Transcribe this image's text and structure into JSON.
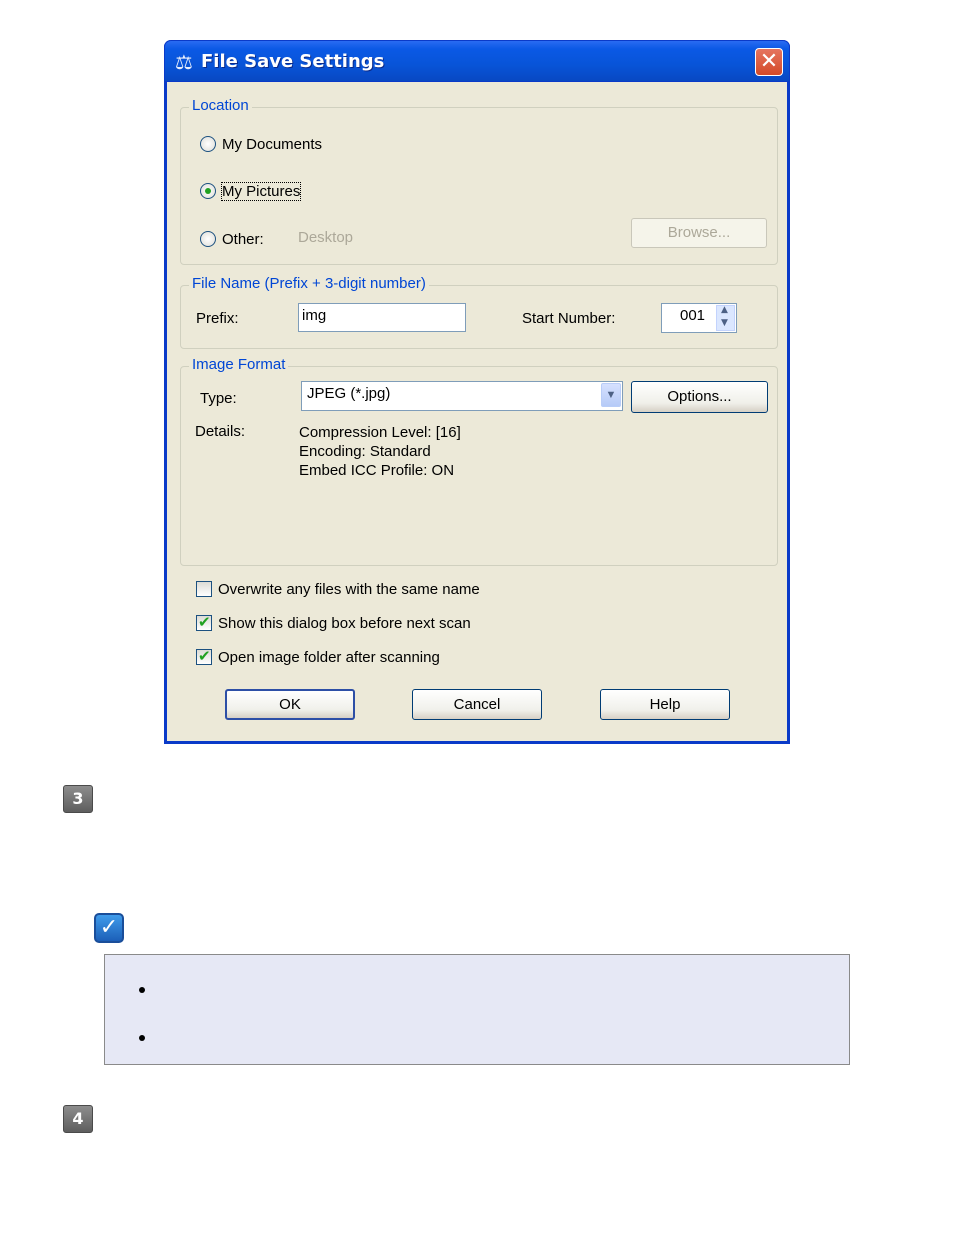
{
  "dialog": {
    "title": "File Save Settings",
    "location": {
      "group_title": "Location",
      "options": [
        "My Documents",
        "My Pictures",
        "Other:"
      ],
      "selected": "My Pictures",
      "other_path": "Desktop",
      "browse_label": "Browse..."
    },
    "file_name": {
      "group_title": "File Name (Prefix + 3-digit number)",
      "prefix_label": "Prefix:",
      "prefix_value": "img",
      "start_number_label": "Start Number:",
      "start_number_value": "001"
    },
    "image_format": {
      "group_title": "Image Format",
      "type_label": "Type:",
      "type_value": "JPEG (*.jpg)",
      "options_label": "Options...",
      "details_label": "Details:",
      "details": [
        "Compression Level: [16]",
        "Encoding: Standard",
        "Embed ICC Profile: ON"
      ]
    },
    "checkboxes": [
      {
        "label": "Overwrite any files with the same name",
        "checked": false
      },
      {
        "label": "Show this dialog box before next scan",
        "checked": true
      },
      {
        "label": "Open image folder after scanning",
        "checked": true
      }
    ],
    "buttons": {
      "ok": "OK",
      "cancel": "Cancel",
      "help": "Help"
    }
  },
  "steps": {
    "step3": "3",
    "step4": "4"
  },
  "note": {
    "icon": "check-icon",
    "bullets": 2
  },
  "colors": {
    "titlebar": "#0854d8",
    "group_title": "#0046d5",
    "dialog_bg": "#ece9d8",
    "note_bg": "#e6e8f5"
  }
}
